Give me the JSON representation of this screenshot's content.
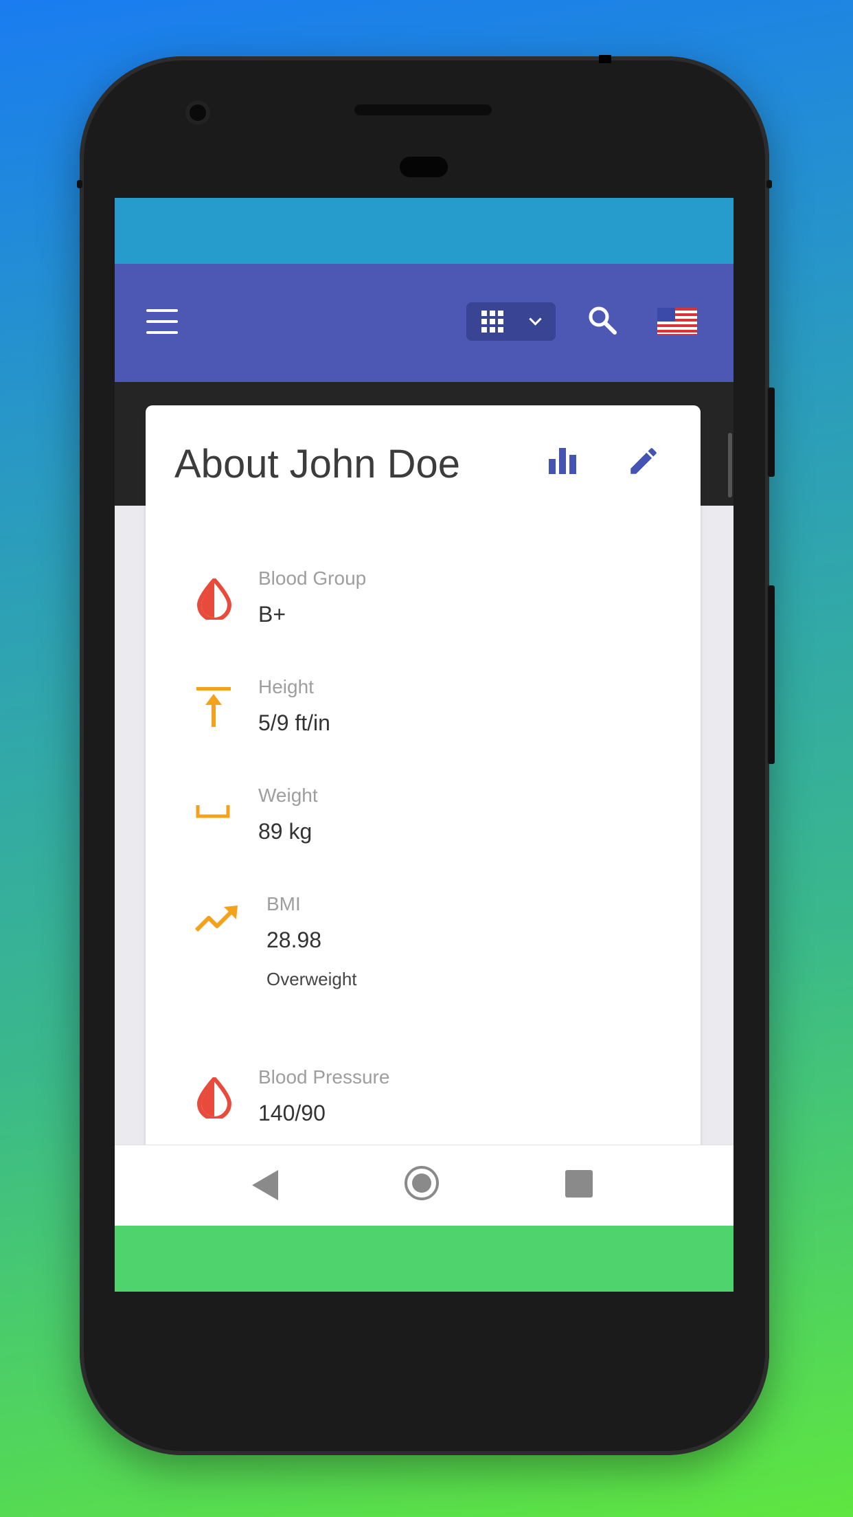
{
  "profile": {
    "title": "About John Doe"
  },
  "details": [
    {
      "label": "Blood Group",
      "value": "B+",
      "icon": "blood-drop-icon",
      "color": "#e84a3b"
    },
    {
      "label": "Height",
      "value": "5/9 ft/in",
      "icon": "height-icon",
      "color": "#f3a21c"
    },
    {
      "label": "Weight",
      "value": "89 kg",
      "icon": "weight-icon",
      "color": "#f3a21c"
    },
    {
      "label": "BMI",
      "value": "28.98",
      "note": "Overweight",
      "icon": "trending-up-icon",
      "color": "#f3a21c"
    },
    {
      "label": "Blood Pressure",
      "value": "140/90",
      "icon": "blood-drop-icon",
      "color": "#e84a3b"
    }
  ],
  "appbar": {
    "menu_icon": "menu-icon",
    "apps_icon": "apps-grid-icon",
    "search_icon": "search-icon",
    "language_icon": "us-flag-icon",
    "color": "#4d58b5"
  },
  "card_actions": {
    "chart_icon": "bar-chart-icon",
    "edit_icon": "edit-pencil-icon",
    "color": "#4553b3"
  },
  "system_nav": {
    "back_icon": "back-icon",
    "home_icon": "home-icon",
    "recent_icon": "recent-apps-icon"
  }
}
